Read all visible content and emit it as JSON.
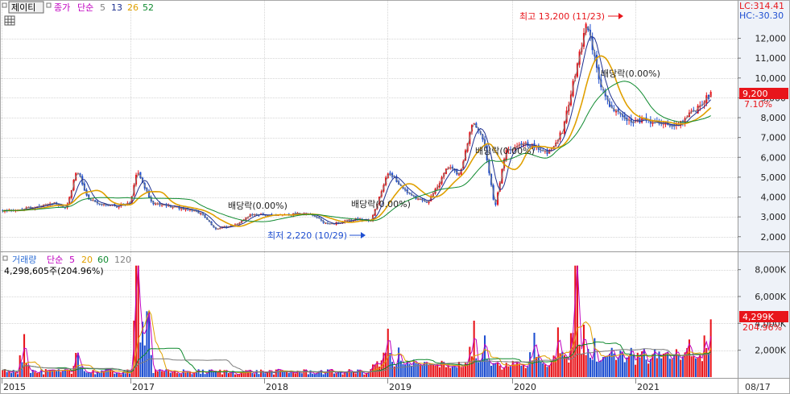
{
  "header": {
    "stock_name": "제이티",
    "close_label": "종가",
    "simple_label": "단순",
    "ma_periods": [
      "5",
      "13",
      "26",
      "52"
    ]
  },
  "volume_header": {
    "volume_label": "거래량",
    "simple_label": "단순",
    "ma_periods": [
      "5",
      "20",
      "60",
      "120"
    ],
    "last_volume_text": "4,298,605주(204.96%)"
  },
  "right_info": {
    "lc_text": "LC:314.41",
    "hc_text": "HC:-30.30",
    "price_badge": "9,200",
    "price_change": "7.10%",
    "volume_badge": "4,299K",
    "volume_change": "204.96%",
    "date_label": "08/17"
  },
  "annotations": {
    "high_text": "최고 13,200 (11/23)",
    "low_text": "최저 2,220 (10/29)",
    "dividend_text": "배당락(0.00%)"
  },
  "colors": {
    "up": "#e8151b",
    "down": "#1f4fd1",
    "ma5": "#7f7f7f",
    "ma13": "#1c2f8f",
    "ma26": "#e0a000",
    "ma52": "#0f8a2f",
    "vol_ma5": "#c000c0",
    "vol_ma20": "#e0a000",
    "vol_ma60": "#0f8a2f",
    "vol_ma120": "#7f7f7f"
  },
  "chart_data": {
    "type": "candlestick",
    "x_axis_labels": [
      "2015",
      "2017",
      "2018",
      "2019",
      "2020",
      "2021"
    ],
    "price_axis": {
      "ticks": [
        2000,
        3000,
        4000,
        5000,
        6000,
        7000,
        8000,
        9000,
        10000,
        11000,
        12000
      ],
      "tick_labels": [
        "2,000",
        "3,000",
        "4,000",
        "5,000",
        "6,000",
        "7,000",
        "8,000",
        "9,000",
        "10,000",
        "11,000",
        "12,000"
      ],
      "range": [
        1300,
        13850
      ]
    },
    "volume_axis": {
      "ticks": [
        2000,
        4000,
        6000,
        8000
      ],
      "tick_labels": [
        "2,000K",
        "4,000K",
        "6,000K",
        "8,000K"
      ],
      "range": [
        0,
        9000
      ]
    },
    "price_path": [
      {
        "t": 0.0,
        "p": 3300
      },
      {
        "t": 0.04,
        "p": 3450
      },
      {
        "t": 0.07,
        "p": 3700
      },
      {
        "t": 0.09,
        "p": 3450
      },
      {
        "t": 0.105,
        "p": 5400
      },
      {
        "t": 0.12,
        "p": 3950
      },
      {
        "t": 0.14,
        "p": 3650
      },
      {
        "t": 0.16,
        "p": 3550
      },
      {
        "t": 0.18,
        "p": 3700
      },
      {
        "t": 0.19,
        "p": 5300
      },
      {
        "t": 0.21,
        "p": 3700
      },
      {
        "t": 0.25,
        "p": 3450
      },
      {
        "t": 0.28,
        "p": 3200
      },
      {
        "t": 0.3,
        "p": 2400
      },
      {
        "t": 0.33,
        "p": 2600
      },
      {
        "t": 0.35,
        "p": 3100
      },
      {
        "t": 0.4,
        "p": 3100
      },
      {
        "t": 0.43,
        "p": 3200
      },
      {
        "t": 0.46,
        "p": 2600
      },
      {
        "t": 0.5,
        "p": 2900
      },
      {
        "t": 0.52,
        "p": 2800
      },
      {
        "t": 0.545,
        "p": 5300
      },
      {
        "t": 0.57,
        "p": 4200
      },
      {
        "t": 0.6,
        "p": 3700
      },
      {
        "t": 0.63,
        "p": 5600
      },
      {
        "t": 0.645,
        "p": 5100
      },
      {
        "t": 0.665,
        "p": 7900
      },
      {
        "t": 0.68,
        "p": 6800
      },
      {
        "t": 0.695,
        "p": 3400
      },
      {
        "t": 0.71,
        "p": 6300
      },
      {
        "t": 0.74,
        "p": 6700
      },
      {
        "t": 0.77,
        "p": 6200
      },
      {
        "t": 0.79,
        "p": 7300
      },
      {
        "t": 0.8,
        "p": 8800
      },
      {
        "t": 0.815,
        "p": 11300
      },
      {
        "t": 0.825,
        "p": 12800
      },
      {
        "t": 0.84,
        "p": 10200
      },
      {
        "t": 0.855,
        "p": 8700
      },
      {
        "t": 0.88,
        "p": 7900
      },
      {
        "t": 0.92,
        "p": 7800
      },
      {
        "t": 0.95,
        "p": 7600
      },
      {
        "t": 0.975,
        "p": 8300
      },
      {
        "t": 1.0,
        "p": 9200
      }
    ],
    "moving_average_periods": [
      5,
      13,
      26,
      52
    ],
    "volume_spikes": [
      {
        "t": 0.03,
        "v": 3200
      },
      {
        "t": 0.105,
        "v": 1800
      },
      {
        "t": 0.19,
        "v": 8300
      },
      {
        "t": 0.205,
        "v": 4900
      },
      {
        "t": 0.545,
        "v": 3600
      },
      {
        "t": 0.56,
        "v": 2200
      },
      {
        "t": 0.665,
        "v": 4200
      },
      {
        "t": 0.68,
        "v": 3100
      },
      {
        "t": 0.75,
        "v": 3300
      },
      {
        "t": 0.785,
        "v": 3700
      },
      {
        "t": 0.81,
        "v": 8300
      },
      {
        "t": 0.82,
        "v": 3900
      },
      {
        "t": 0.835,
        "v": 2900
      },
      {
        "t": 0.97,
        "v": 2800
      },
      {
        "t": 0.99,
        "v": 3100
      },
      {
        "t": 1.0,
        "v": 4300
      }
    ],
    "volume_ma_periods": [
      5,
      20,
      60,
      120
    ]
  }
}
